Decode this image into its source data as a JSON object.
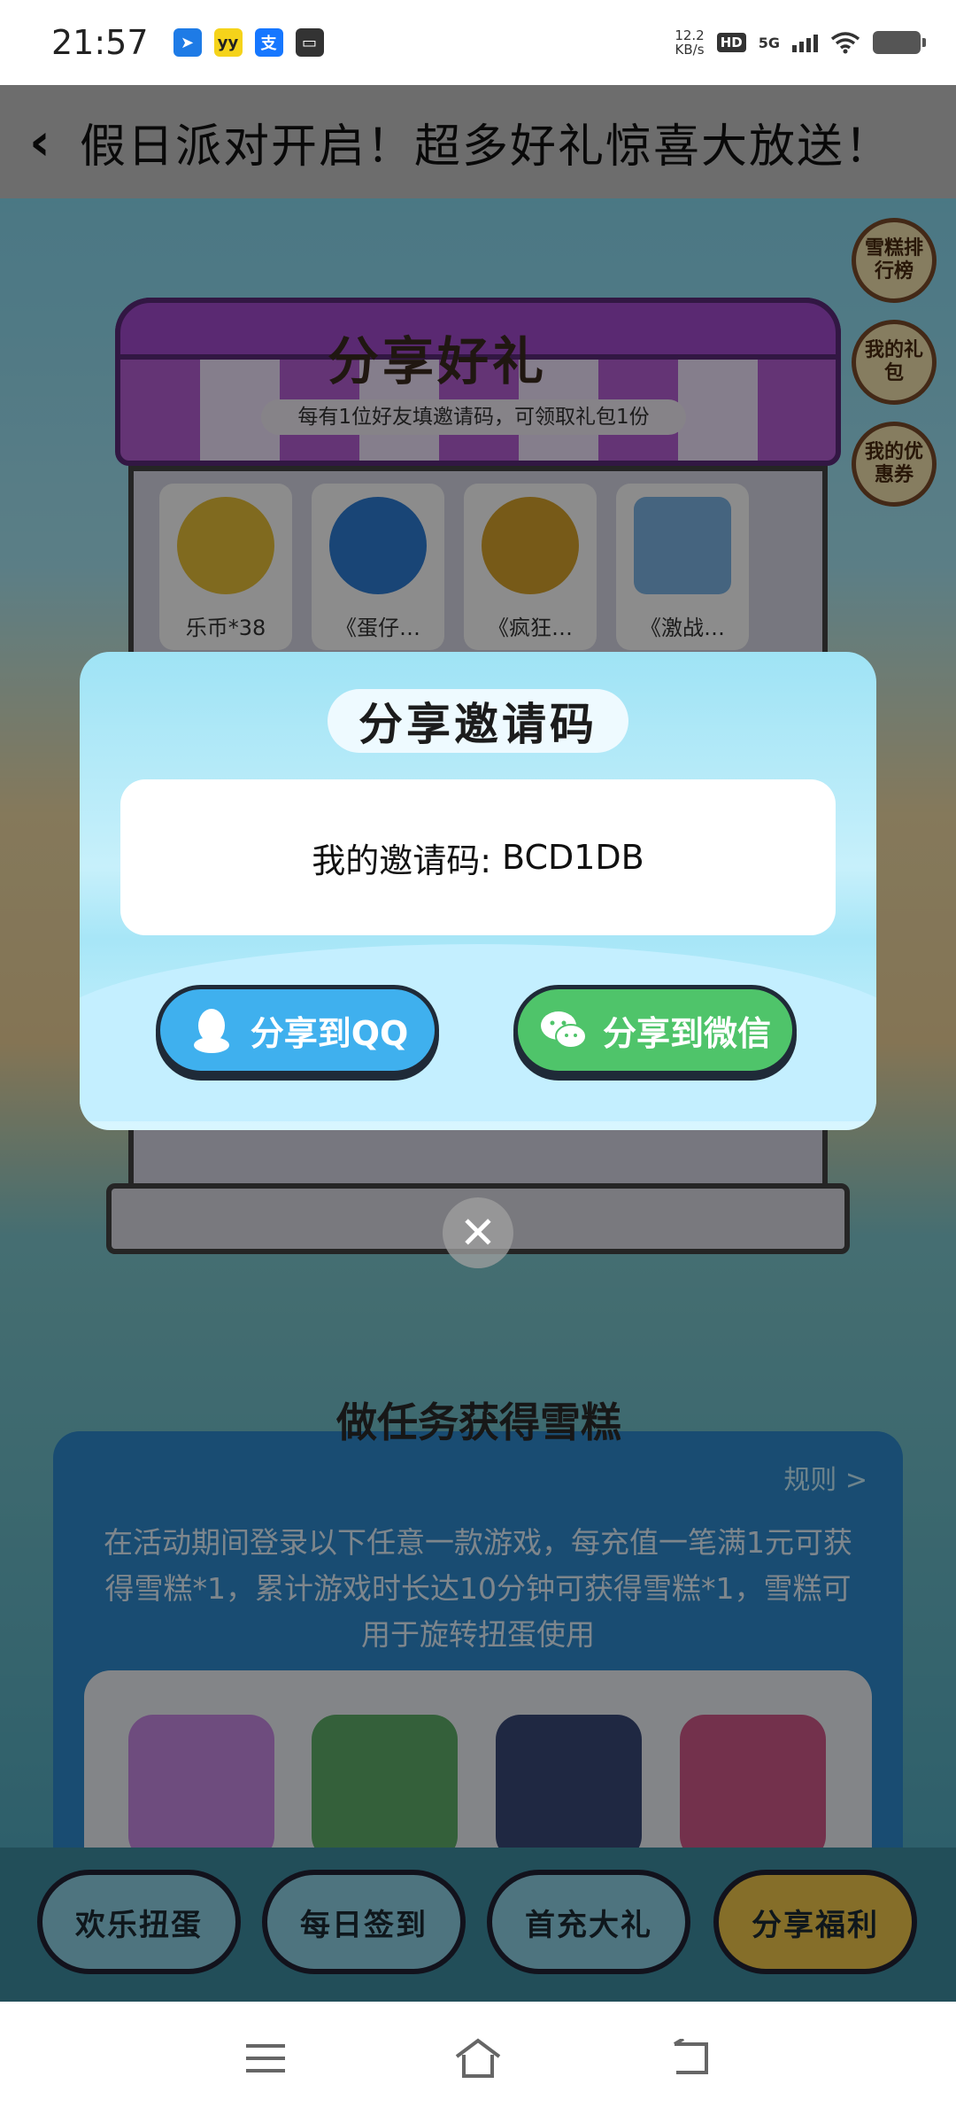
{
  "status_bar": {
    "time": "21:57",
    "network_speed_value": "12.2",
    "network_speed_unit": "KB/s",
    "hd": "HD",
    "network": "5G",
    "app_icons": [
      "bluetooth-app-icon",
      "yy-app-icon",
      "alipay-app-icon",
      "message-app-icon"
    ]
  },
  "header": {
    "title": "假日派对开启！超多好礼惊喜大放送！"
  },
  "shop": {
    "title": "分享好礼",
    "subtitle": "每有1位好友填邀请码，可领取礼包1份",
    "gifts": [
      {
        "label": "乐币*38",
        "color": "#e9c23a"
      },
      {
        "label": "《蛋仔…",
        "color": "#2f7fd8"
      },
      {
        "label": "《疯狂…",
        "color": "#d9a52c"
      },
      {
        "label": "《激战…",
        "color": "#7fb7e8"
      }
    ]
  },
  "side_buttons": [
    {
      "label": "雪糕排行榜"
    },
    {
      "label": "我的礼包"
    },
    {
      "label": "我的优惠券"
    }
  ],
  "tasks": {
    "title": "做任务获得雪糕",
    "rules_link": "规则 >",
    "description": "在活动期间登录以下任意一款游戏，每充值一笔满1元可获得雪糕*1，累计游戏时长达10分钟可获得雪糕*1，雪糕可用于旋转扭蛋使用",
    "games": [
      {
        "name": "eggy-party-icon",
        "color": "#c88be6"
      },
      {
        "name": "mini-world-icon",
        "color": "#5fb06a"
      },
      {
        "name": "ultraman-icon",
        "color": "#3a4a78"
      },
      {
        "name": "subway-surfers-icon",
        "color": "#d25a8a"
      }
    ]
  },
  "tabs": [
    {
      "label": "欢乐扭蛋",
      "active": false
    },
    {
      "label": "每日签到",
      "active": false
    },
    {
      "label": "首充大礼",
      "active": false
    },
    {
      "label": "分享福利",
      "active": true
    }
  ],
  "modal": {
    "title": "分享邀请码",
    "code_label": "我的邀请码:",
    "code_value": "BCD1DB",
    "share_qq": "分享到QQ",
    "share_wechat": "分享到微信",
    "colors": {
      "qq": "#3fb0ee",
      "wechat": "#4fc46a"
    }
  }
}
